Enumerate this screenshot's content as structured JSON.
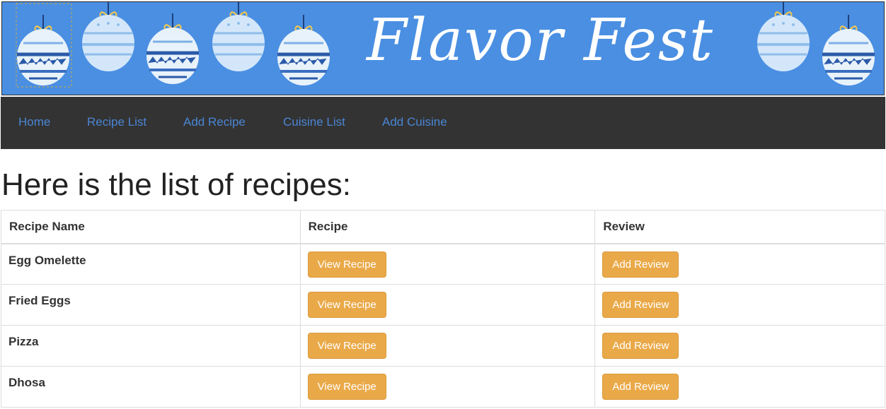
{
  "banner": {
    "title": "Flavor Fest",
    "background": "#4a8fe2",
    "ornament_icon": "easter-egg-ornament"
  },
  "nav": {
    "items": [
      {
        "label": "Home"
      },
      {
        "label": "Recipe List"
      },
      {
        "label": "Add Recipe"
      },
      {
        "label": "Cuisine List"
      },
      {
        "label": "Add Cuisine"
      }
    ],
    "link_color": "#4a86d4",
    "background": "#333333"
  },
  "page": {
    "heading": "Here is the list of recipes:"
  },
  "table": {
    "headers": [
      "Recipe Name",
      "Recipe",
      "Review"
    ],
    "rows": [
      {
        "name": "Egg Omelette",
        "view_label": "View Recipe",
        "review_label": "Add Review"
      },
      {
        "name": "Fried Eggs",
        "view_label": "View Recipe",
        "review_label": "Add Review"
      },
      {
        "name": "Pizza",
        "view_label": "View Recipe",
        "review_label": "Add Review"
      },
      {
        "name": "Dhosa",
        "view_label": "View Recipe",
        "review_label": "Add Review"
      }
    ],
    "button_color": "#eaa948"
  }
}
